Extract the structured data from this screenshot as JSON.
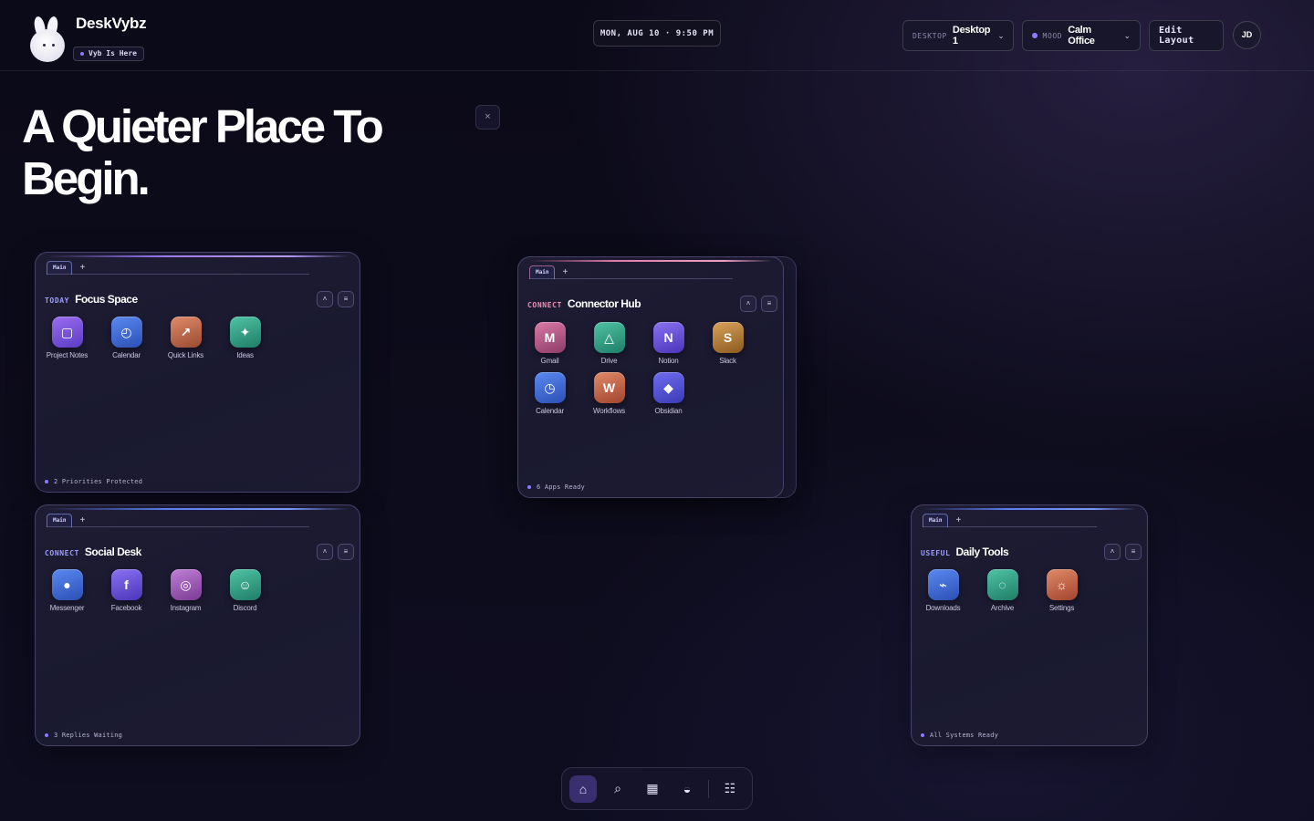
{
  "brand": {
    "name": "DeskVybz",
    "status": "Vyb Is Here"
  },
  "clock": "MON, AUG 10 · 9:50 PM",
  "desktop": {
    "label": "DESKTOP",
    "value": "Desktop 1"
  },
  "mood": {
    "label": "MOOD",
    "value": "Calm Office"
  },
  "edit_layout": "Edit Layout",
  "avatar": "JD",
  "hero": {
    "title": "A Quieter Place To Begin."
  },
  "close_glyph": "×",
  "tab_main": "Main",
  "tab_add": "+",
  "widgets": {
    "focus": {
      "kicker": "TODAY",
      "title": "Focus Space",
      "apps": [
        {
          "label": "Project Notes",
          "icon": "note-icon",
          "glyph": "▢"
        },
        {
          "label": "Calendar",
          "icon": "calendar-icon",
          "glyph": "◴"
        },
        {
          "label": "Quick Links",
          "icon": "link-icon",
          "glyph": "↗"
        },
        {
          "label": "Ideas",
          "icon": "sparkle-icon",
          "glyph": "✦"
        }
      ],
      "footer": "2 Priorities Protected"
    },
    "connector": {
      "kicker": "CONNECT",
      "title": "Connector Hub",
      "apps": [
        {
          "label": "Gmail",
          "icon": "gmail-icon",
          "glyph": "M"
        },
        {
          "label": "Drive",
          "icon": "drive-icon",
          "glyph": "△"
        },
        {
          "label": "Notion",
          "icon": "notion-icon",
          "glyph": "N"
        },
        {
          "label": "Slack",
          "icon": "slack-icon",
          "glyph": "S"
        },
        {
          "label": "Calendar",
          "icon": "calendar-icon",
          "glyph": "◷"
        },
        {
          "label": "Workflows",
          "icon": "workflows-icon",
          "glyph": "W"
        },
        {
          "label": "Obsidian",
          "icon": "obsidian-icon",
          "glyph": "◆"
        }
      ],
      "footer": "6 Apps Ready"
    },
    "social": {
      "kicker": "CONNECT",
      "title": "Social Desk",
      "apps": [
        {
          "label": "Messenger",
          "icon": "messenger-icon",
          "glyph": "●"
        },
        {
          "label": "Facebook",
          "icon": "facebook-icon",
          "glyph": "f"
        },
        {
          "label": "Instagram",
          "icon": "instagram-icon",
          "glyph": "◎"
        },
        {
          "label": "Discord",
          "icon": "discord-icon",
          "glyph": "☺"
        }
      ],
      "footer": "3 Replies Waiting"
    },
    "daily": {
      "kicker": "USEFUL",
      "title": "Daily Tools",
      "apps": [
        {
          "label": "Downloads",
          "icon": "download-icon",
          "glyph": "⌁"
        },
        {
          "label": "Archive",
          "icon": "archive-icon",
          "glyph": "◌"
        },
        {
          "label": "Settings",
          "icon": "gear-icon",
          "glyph": "☼"
        }
      ],
      "footer": "All Systems Ready"
    }
  },
  "widget_controls": {
    "collapse": "˄",
    "menu": "≡"
  },
  "dock": [
    {
      "name": "home-icon",
      "glyph": "⌂"
    },
    {
      "name": "search-icon",
      "glyph": "⌕"
    },
    {
      "name": "grid-icon",
      "glyph": "▦"
    },
    {
      "name": "theme-icon",
      "glyph": "◒"
    },
    {
      "name": "list-icon",
      "glyph": "☷"
    }
  ],
  "colors": {
    "accent": "#8b7bff",
    "background": "#0c0b1a"
  }
}
